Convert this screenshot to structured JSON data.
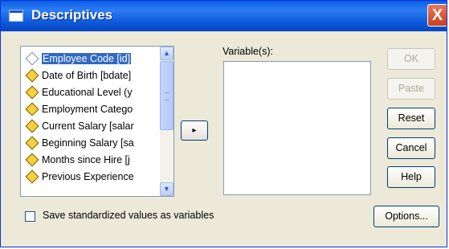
{
  "window": {
    "title": "Descriptives",
    "close_glyph": "X"
  },
  "source_list": {
    "items": [
      {
        "label": "Employee Code [id]",
        "icon": "id-variable-icon",
        "selected": true
      },
      {
        "label": "Date of Birth [bdate]",
        "icon": "scale-variable-icon"
      },
      {
        "label": "Educational Level (y",
        "icon": "scale-variable-icon"
      },
      {
        "label": "Employment Catego",
        "icon": "scale-variable-icon"
      },
      {
        "label": "Current Salary [salar",
        "icon": "scale-variable-icon"
      },
      {
        "label": "Beginning Salary [sa",
        "icon": "scale-variable-icon"
      },
      {
        "label": "Months since Hire [j",
        "icon": "scale-variable-icon"
      },
      {
        "label": "Previous Experience",
        "icon": "scale-variable-icon"
      }
    ]
  },
  "move_button": {
    "glyph": "▸"
  },
  "variables": {
    "label": "Variable(s):"
  },
  "buttons": {
    "ok": "OK",
    "paste": "Paste",
    "reset": "Reset",
    "cancel": "Cancel",
    "help": "Help",
    "options": "Options..."
  },
  "save_checkbox": {
    "label": "Save standardized values as variables",
    "checked": false
  }
}
